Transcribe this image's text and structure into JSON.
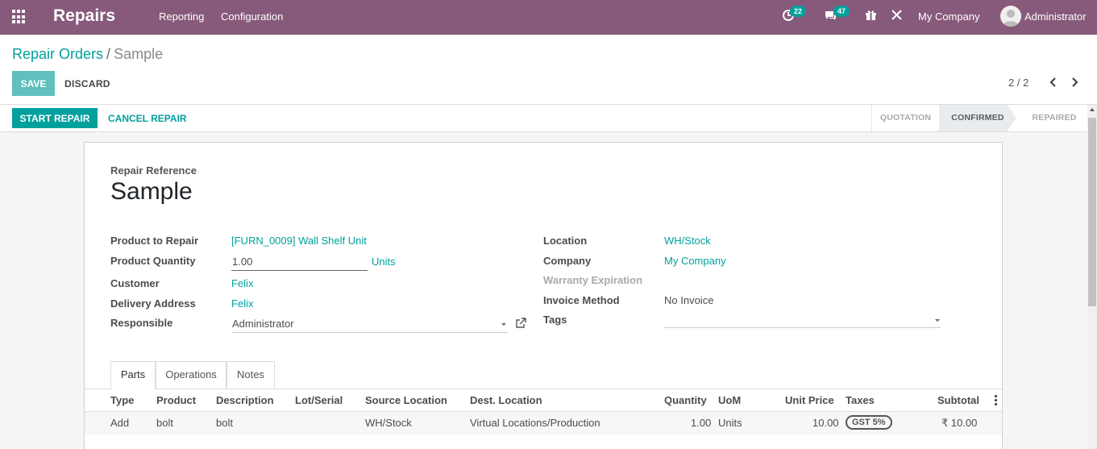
{
  "nav": {
    "app_name": "Repairs",
    "menu": [
      "Reporting",
      "Configuration"
    ],
    "activity_count": "22",
    "messages_count": "47",
    "company": "My Company",
    "user": "Administrator"
  },
  "control_panel": {
    "breadcrumb_parent": "Repair Orders",
    "breadcrumb_sep": "/",
    "breadcrumb_current": "Sample",
    "save_label": "SAVE",
    "discard_label": "DISCARD",
    "pager": "2 / 2"
  },
  "status": {
    "start_repair": "START REPAIR",
    "cancel_repair": "CANCEL REPAIR",
    "stages": [
      "QUOTATION",
      "CONFIRMED",
      "REPAIRED"
    ],
    "active_stage": "CONFIRMED"
  },
  "form": {
    "ref_label": "Repair Reference",
    "ref_value": "Sample",
    "left": {
      "product_label": "Product to Repair",
      "product_value": "[FURN_0009] Wall Shelf Unit",
      "qty_label": "Product Quantity",
      "qty_value": "1.00",
      "qty_uom": "Units",
      "customer_label": "Customer",
      "customer_value": "Felix",
      "delivery_label": "Delivery Address",
      "delivery_value": "Felix",
      "responsible_label": "Responsible",
      "responsible_value": "Administrator"
    },
    "right": {
      "location_label": "Location",
      "location_value": "WH/Stock",
      "company_label": "Company",
      "company_value": "My Company",
      "warranty_label": "Warranty Expiration",
      "invoice_label": "Invoice Method",
      "invoice_value": "No Invoice",
      "tags_label": "Tags"
    }
  },
  "tabs": [
    "Parts",
    "Operations",
    "Notes"
  ],
  "active_tab": "Parts",
  "parts_table": {
    "columns": [
      "Type",
      "Product",
      "Description",
      "Lot/Serial",
      "Source Location",
      "Dest. Location",
      "Quantity",
      "UoM",
      "Unit Price",
      "Taxes",
      "Subtotal"
    ],
    "rows": [
      {
        "type": "Add",
        "product": "bolt",
        "description": "bolt",
        "lot": "",
        "source": "WH/Stock",
        "dest": "Virtual Locations/Production",
        "quantity": "1.00",
        "uom": "Units",
        "unit_price": "10.00",
        "taxes": "GST 5%",
        "subtotal": "₹ 10.00"
      }
    ]
  },
  "colors": {
    "brand": "#875a7b",
    "accent": "#00a09d"
  }
}
